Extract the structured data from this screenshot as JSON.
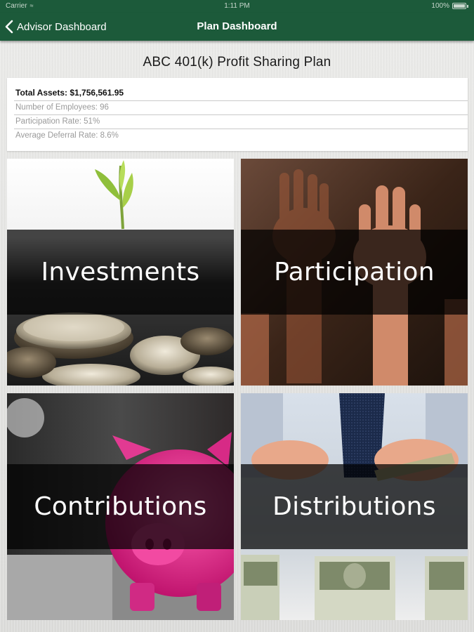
{
  "status_bar": {
    "carrier": "Carrier",
    "time": "1:11 PM",
    "battery": "100%"
  },
  "nav": {
    "back_label": "Advisor Dashboard",
    "title": "Plan Dashboard"
  },
  "plan": {
    "title": "ABC 401(k) Profit Sharing Plan",
    "total_assets": "Total Assets: $1,756,561.95",
    "employees": "Number of Employees: 96",
    "participation_rate": "Participation Rate: 51%",
    "deferral_rate": "Average Deferral Rate: 8.6%"
  },
  "tiles": [
    {
      "label": "Investments",
      "image": "seedling-on-coins"
    },
    {
      "label": "Participation",
      "image": "raised-hands"
    },
    {
      "label": "Contributions",
      "image": "pink-piggy-bank"
    },
    {
      "label": "Distributions",
      "image": "hands-with-cash"
    }
  ],
  "colors": {
    "brand_green": "#1c5a3a",
    "band_overlay": "#000000"
  }
}
